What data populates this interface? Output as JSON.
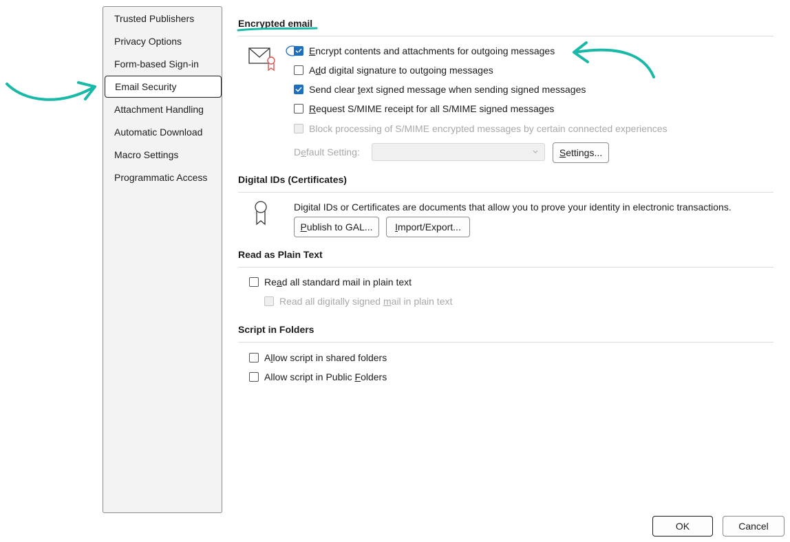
{
  "nav": {
    "items": [
      {
        "label": "Trusted Publishers"
      },
      {
        "label": "Privacy Options"
      },
      {
        "label": "Form-based Sign-in"
      },
      {
        "label": "Email Security",
        "selected": true
      },
      {
        "label": "Attachment Handling"
      },
      {
        "label": "Automatic Download"
      },
      {
        "label": "Macro Settings"
      },
      {
        "label": "Programmatic Access"
      }
    ]
  },
  "encrypted_email": {
    "title": "Encrypted email",
    "options": [
      {
        "pre": "",
        "key": "E",
        "post": "ncrypt contents and attachments for outgoing messages",
        "checked": true,
        "disabled": false
      },
      {
        "pre": "A",
        "key": "d",
        "post": "d digital signature to outgoing messages",
        "checked": false,
        "disabled": false
      },
      {
        "pre": "Send clear ",
        "key": "t",
        "post": "ext signed message when sending signed messages",
        "checked": true,
        "disabled": false
      },
      {
        "pre": "",
        "key": "R",
        "post": "equest S/MIME receipt for all S/MIME signed messages",
        "checked": false,
        "disabled": false
      },
      {
        "pre": "Block processing of S/MIME encrypted messages by certain connected experiences",
        "key": "",
        "post": "",
        "checked": false,
        "disabled": true
      }
    ],
    "default_setting": {
      "pre": "D",
      "key": "e",
      "post": "fault Setting:",
      "value": ""
    },
    "settings_button": {
      "pre": "",
      "key": "S",
      "post": "ettings..."
    }
  },
  "digital_ids": {
    "title": "Digital IDs (Certificates)",
    "description": "Digital IDs or Certificates are documents that allow you to prove your identity in electronic transactions.",
    "publish_button": {
      "pre": "",
      "key": "P",
      "post": "ublish to GAL..."
    },
    "import_button": {
      "pre": "",
      "key": "I",
      "post": "mport/Export..."
    }
  },
  "plain_text": {
    "title": "Read as Plain Text",
    "options": [
      {
        "pre": "Re",
        "key": "a",
        "post": "d all standard mail in plain text",
        "checked": false,
        "disabled": false
      },
      {
        "pre": "Read all digitally signed ",
        "key": "m",
        "post": "ail in plain text",
        "checked": false,
        "disabled": true
      }
    ]
  },
  "script_folders": {
    "title": "Script in Folders",
    "options": [
      {
        "pre": "A",
        "key": "l",
        "post": "low script in shared folders",
        "checked": false,
        "disabled": false
      },
      {
        "pre": "Allow script in Public ",
        "key": "F",
        "post": "olders",
        "checked": false,
        "disabled": false
      }
    ]
  },
  "footer": {
    "ok": "OK",
    "cancel": "Cancel"
  },
  "icons": {
    "envelope": "envelope-certificate-icon",
    "certificate": "certificate-ribbon-icon",
    "checkmark": "checkmark-icon",
    "chevron": "chevron-down-icon"
  },
  "colors": {
    "accent": "#1f6fc0",
    "annotation": "#1ab8a6",
    "ribbon": "#d9534f"
  }
}
